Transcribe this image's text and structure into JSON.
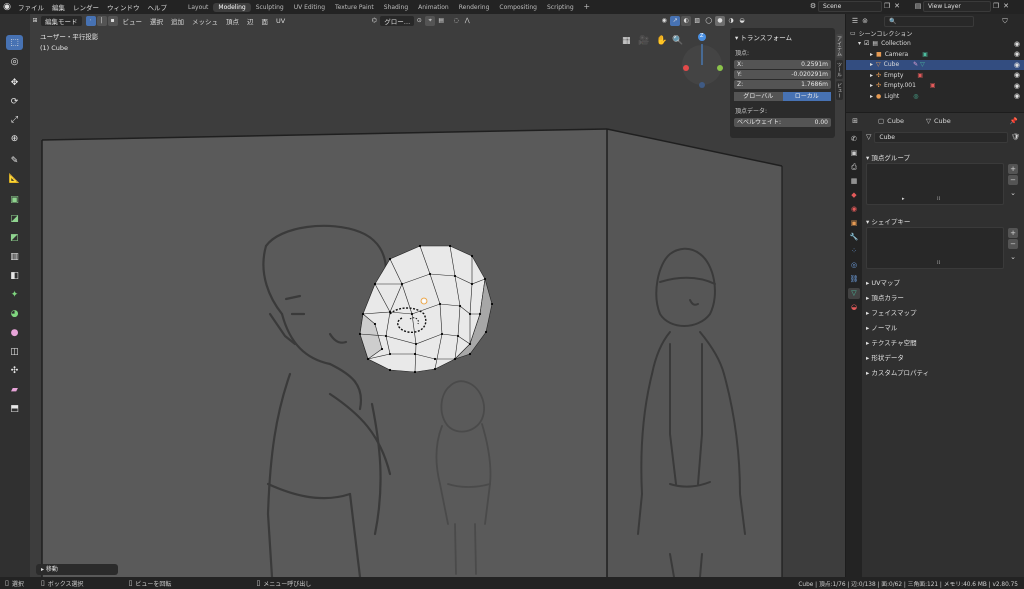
{
  "app": {
    "menu": [
      "ファイル",
      "編集",
      "レンダー",
      "ウィンドウ",
      "ヘルプ"
    ],
    "workspaces": [
      "Layout",
      "Modeling",
      "Sculpting",
      "UV Editing",
      "Texture Paint",
      "Shading",
      "Animation",
      "Rendering",
      "Compositing",
      "Scripting"
    ],
    "active_workspace": "Modeling",
    "add_tab": "+",
    "scene": "Scene",
    "view_layer": "View Layer"
  },
  "viewport": {
    "mode": "編集モード",
    "menus": [
      "ビュー",
      "選択",
      "追加",
      "メッシュ",
      "頂点",
      "辺",
      "面",
      "UV"
    ],
    "transform_orientation": "グロー…",
    "overlay_title": "ユーザー・平行投影",
    "overlay_object": "(1) Cube",
    "last_operator": "移動",
    "gizmo": {
      "x": "X",
      "y": "Y",
      "z": "Z"
    }
  },
  "transform_panel": {
    "title": "トランスフォーム",
    "vertex_label": "頂点:",
    "x_label": "X:",
    "x_value": "0.2591m",
    "y_label": "Y:",
    "y_value": "-0.020291m",
    "z_label": "Z:",
    "z_value": "1.7686m",
    "global_label": "グローバル",
    "local_label": "ローカル",
    "vertex_data_label": "頂点データ:",
    "bevel_label": "ベベルウェイト:",
    "bevel_value": "0.00",
    "tabs": [
      "アイテム",
      "ツール",
      "ビュー"
    ]
  },
  "outliner": {
    "search_placeholder": "",
    "title": "シーンコレクション",
    "items": [
      {
        "label": "Collection",
        "icon_color": "#e0e0e0"
      },
      {
        "label": "Camera",
        "icon_color": "#e79b53"
      },
      {
        "label": "Cube",
        "icon_color": "#e79b53"
      },
      {
        "label": "Empty",
        "icon_color": "#e79b53"
      },
      {
        "label": "Empty.001",
        "icon_color": "#e79b53"
      },
      {
        "label": "Light",
        "icon_color": "#e79b53"
      }
    ]
  },
  "properties": {
    "breadcrumb_object": "Cube",
    "breadcrumb_mesh": "Cube",
    "mesh_name": "Cube",
    "vertex_groups": "頂点グループ",
    "shape_keys": "シェイプキー",
    "collapsed_sections": [
      "UVマップ",
      "頂点カラー",
      "フェイスマップ",
      "ノーマル",
      "テクスチャ空間",
      "形状データ",
      "カスタムプロパティ"
    ]
  },
  "statusbar": {
    "select": "選択",
    "box_select": "ボックス選択",
    "rotate_view": "ビューを回転",
    "call_menu": "メニュー呼び出し",
    "stats": "Cube | 頂点:1/76 | 辺:0/138 | 面:0/62 | 三角面:121 | メモリ:40.6 MB | v2.80.75"
  },
  "colors": {
    "accent": "#4772b3",
    "selection": "#334d80",
    "viewport_bg": "#3d3d3d",
    "mesh_face": "#e8e8e8",
    "axis_x": "#e34a4a",
    "axis_y": "#8bc34a",
    "axis_z": "#4a90e3"
  }
}
